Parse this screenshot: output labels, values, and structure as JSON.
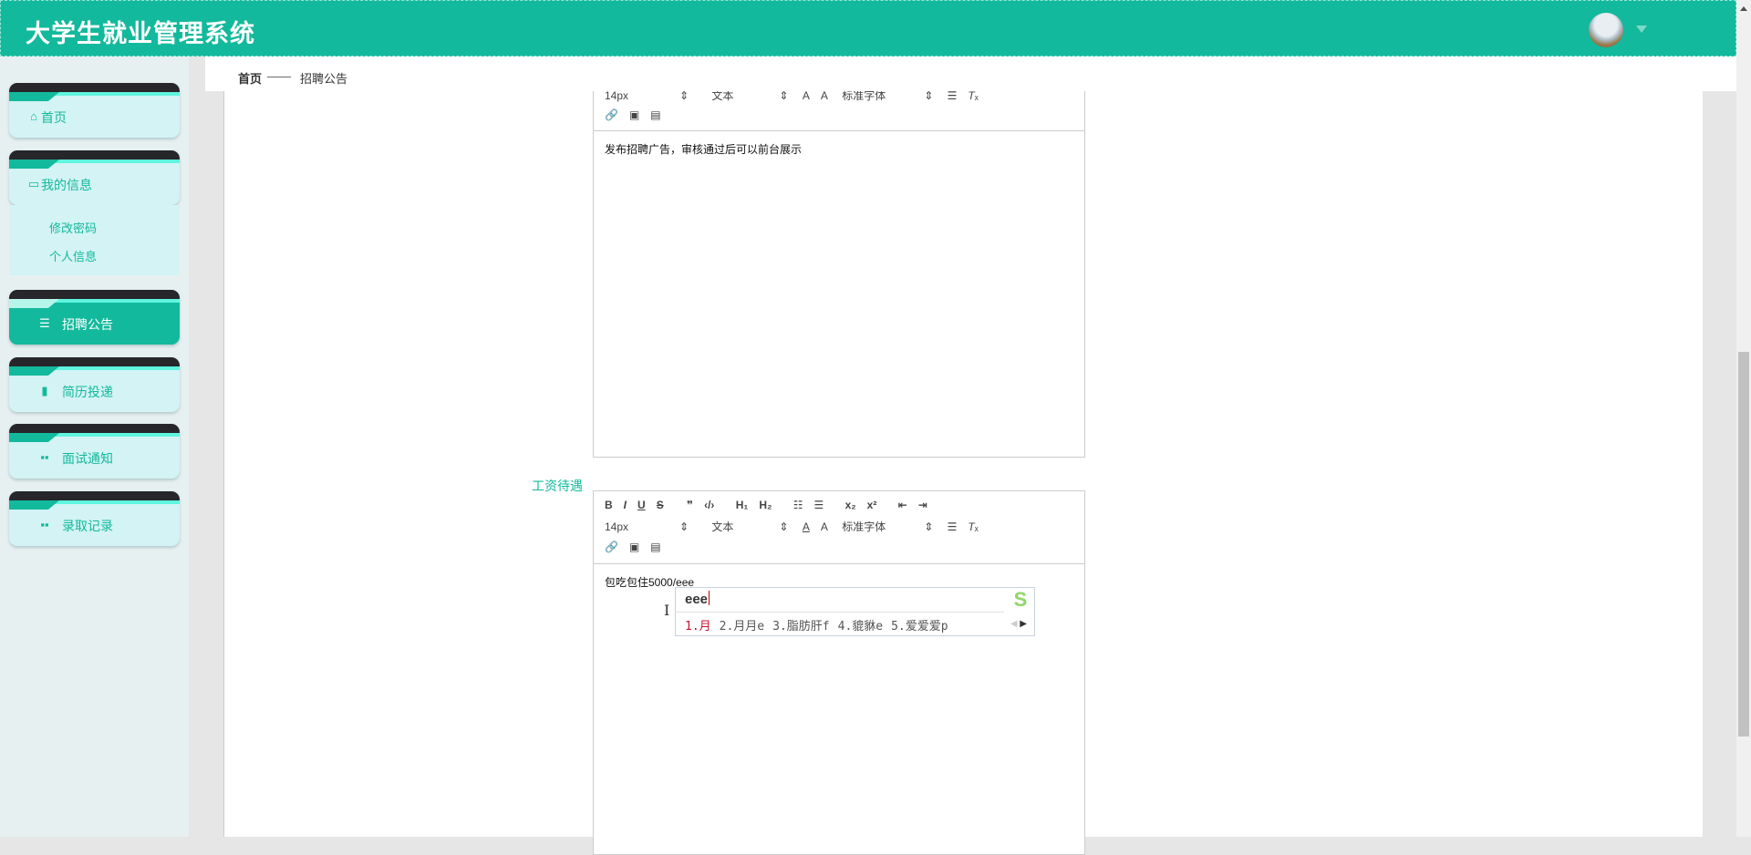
{
  "header": {
    "title": "大学生就业管理系统",
    "avatar_icon": "user-avatar",
    "dropdown_icon": "caret-down-icon"
  },
  "breadcrumb": {
    "home": "首页",
    "separator": "——",
    "current": "招聘公告"
  },
  "sidebar": {
    "items": [
      {
        "label": "首页",
        "icon": "home-icon"
      },
      {
        "label": "我的信息",
        "icon": "card-icon",
        "children": [
          {
            "label": "修改密码"
          },
          {
            "label": "个人信息"
          }
        ]
      },
      {
        "label": "招聘公告",
        "icon": "sliders-icon",
        "active": true
      },
      {
        "label": "简历投递",
        "icon": "book-icon"
      },
      {
        "label": "面试通知",
        "icon": "grid-icon"
      },
      {
        "label": "录取记录",
        "icon": "grid-icon"
      }
    ]
  },
  "form": {
    "editor1": {
      "toolbar_size": "14px",
      "toolbar_heading": "文本",
      "toolbar_font": "标准字体",
      "content": "发布招聘广告，审核通过后可以前台展示"
    },
    "salary_label": "工资待遇",
    "editor2": {
      "toolbar_size": "14px",
      "toolbar_heading": "文本",
      "toolbar_font": "标准字体",
      "content": "包吃包住5000/eee"
    }
  },
  "ime": {
    "composition": "eee",
    "candidates": [
      "1.月",
      "2.月月e",
      "3.脂肪肝f",
      "4.貔貅e",
      "5.爱爱爱p"
    ],
    "logo": "S"
  },
  "colors": {
    "brand": "#13b99c",
    "sidebar_bg": "#d3f3f4",
    "card_top": "#26262b"
  }
}
